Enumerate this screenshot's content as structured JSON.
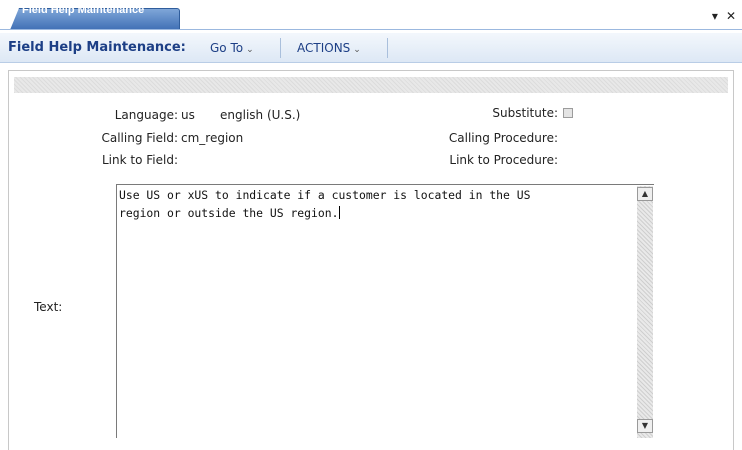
{
  "tab": {
    "label": "Field Help Maintenance"
  },
  "window_controls": {
    "menu_glyph": "▾",
    "close_glyph": "✕"
  },
  "toolbar": {
    "title": "Field Help Maintenance:",
    "goto_label": "Go To",
    "actions_label": "ACTIONS",
    "caret_glyph": "⌄"
  },
  "form": {
    "language_label": "Language:",
    "language_code": "us",
    "language_name": "english (U.S.)",
    "substitute_label": "Substitute:",
    "substitute_checked": false,
    "calling_field_label": "Calling Field:",
    "calling_field_value": "cm_region",
    "calling_procedure_label": "Calling Procedure:",
    "calling_procedure_value": "",
    "link_to_field_label": "Link to Field:",
    "link_to_field_value": "",
    "link_to_procedure_label": "Link to Procedure:",
    "link_to_procedure_value": "",
    "text_label": "Text:",
    "text_line1": "Use US or xUS to indicate if a customer is located in the US",
    "text_line2": "region or outside the US region."
  },
  "icons": {
    "window_menu": "chevron-down-icon",
    "window_close": "close-icon",
    "scroll_up": "arrow-up-icon",
    "scroll_down": "arrow-down-icon"
  },
  "colors": {
    "tab_blue": "#3f6fb5",
    "toolbar_text": "#1d3f86",
    "toolbar_bg": "#dde8f5"
  }
}
